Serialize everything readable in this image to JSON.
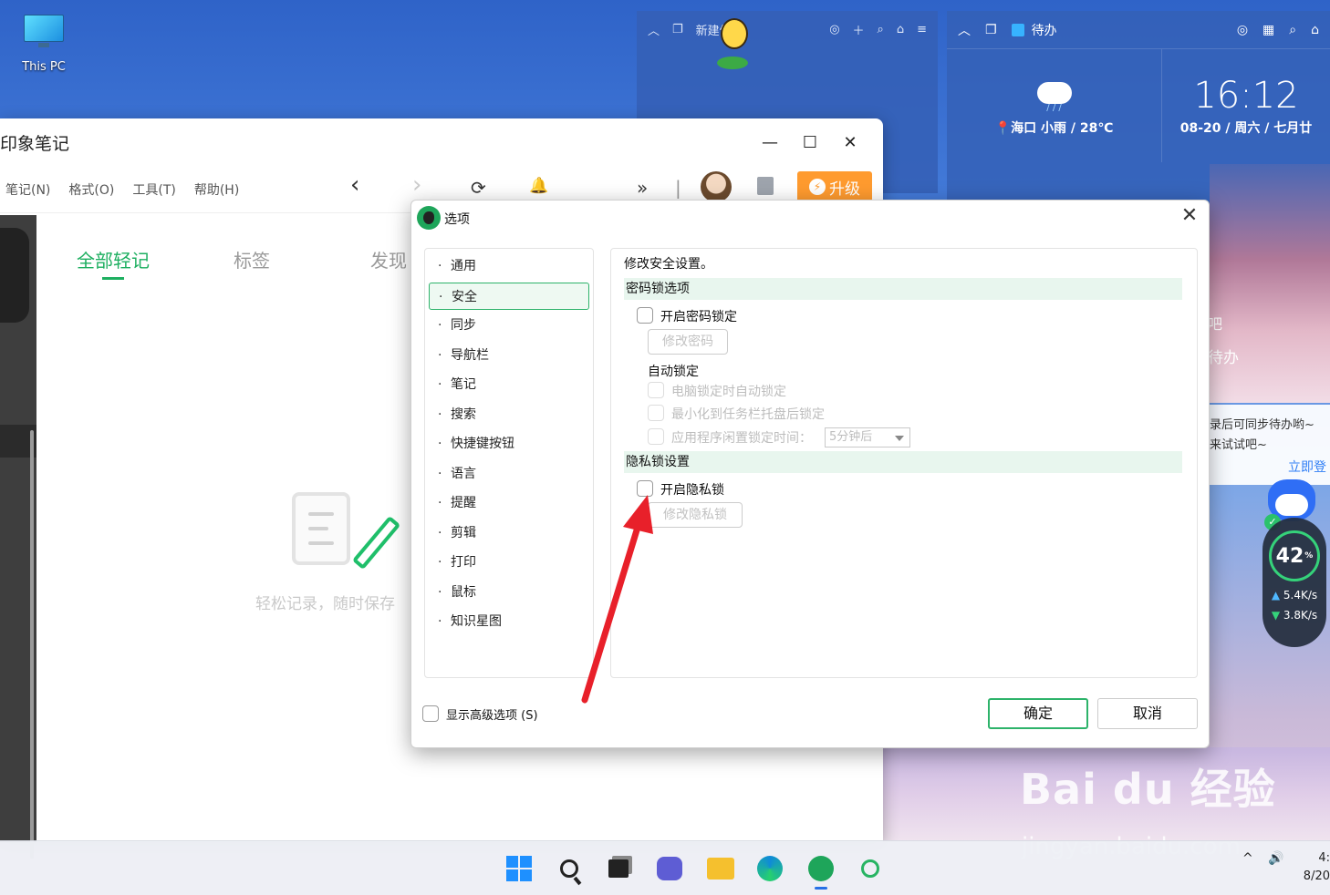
{
  "desktop": {
    "icon_label": "This PC"
  },
  "widget_notes": {
    "title": "新建便签",
    "toolbar_icons": [
      "collapse-icon",
      "pin-icon",
      "user-icon",
      "add-icon",
      "search-icon",
      "skin-icon",
      "menu-icon"
    ]
  },
  "widget_todo": {
    "title": "待办",
    "weather": {
      "location": "海口 小雨 / 28℃",
      "rain": "/ / /"
    },
    "clock": {
      "time": "16:12",
      "date": "08-20 / 周六 / 七月廿"
    },
    "side_text_1": "吧",
    "side_text_2": "待办",
    "notice_line1": "录后可同步待办哟~",
    "notice_line2": "来试试吧~",
    "notice_link": "立即登"
  },
  "speed_widget": {
    "percent": "42",
    "percent_unit": "%",
    "up": "5.4",
    "down": "3.8",
    "unit": "K/s",
    "up_arrow": "▲",
    "down_arrow": "▼",
    "check": "✓"
  },
  "watermark": {
    "brand": "Bai du 经验",
    "url": "jingyan.baidu.com"
  },
  "app": {
    "title": "印象笔记",
    "window_buttons": {
      "minimize": "—",
      "maximize": "☐",
      "close": "✕"
    },
    "menu": [
      "笔记(N)",
      "格式(O)",
      "工具(T)",
      "帮助(H)"
    ],
    "toolbar": {
      "back": "‹",
      "forward": "›",
      "sync": "⟳",
      "bell": "🔔",
      "more": "»",
      "separator": "|"
    },
    "upgrade_label": "升级",
    "upgrade_bolt": "⚡",
    "tabs": {
      "all": "全部轻记",
      "tags": "标签",
      "discover": "发现"
    },
    "empty_text": "轻松记录，随时保存"
  },
  "dialog": {
    "title": "选项",
    "close": "✕",
    "nav": [
      "通用",
      "安全",
      "同步",
      "导航栏",
      "笔记",
      "搜索",
      "快捷键按钮",
      "语言",
      "提醒",
      "剪辑",
      "打印",
      "鼠标",
      "知识星图"
    ],
    "active_nav": "安全",
    "panel": {
      "header": "修改安全设置。",
      "password_section": "密码锁选项",
      "enable_password_lock": "开启密码锁定",
      "change_password": "修改密码",
      "auto_lock": "自动锁定",
      "lock_on_pc_lock": "电脑锁定时自动锁定",
      "lock_on_minimize": "最小化到任务栏托盘后锁定",
      "lock_on_idle": "应用程序闲置锁定时间：",
      "idle_value": "5分钟后",
      "privacy_section": "隐私锁设置",
      "enable_privacy_lock": "开启隐私锁",
      "change_privacy_lock": "修改隐私锁"
    },
    "show_advanced": "显示高级选项 (S)",
    "ok": "确定",
    "cancel": "取消"
  },
  "annotation": {
    "color": "#e8202a"
  },
  "taskbar": {
    "apps": [
      "windows-start-icon",
      "search-icon",
      "task-view-icon",
      "chat-icon",
      "file-explorer-icon",
      "edge-icon",
      "evernote-icon",
      "green-search-icon"
    ],
    "tray_chevron": "^",
    "tray_volume": "🔊",
    "time": "4:",
    "date": "8/20"
  }
}
